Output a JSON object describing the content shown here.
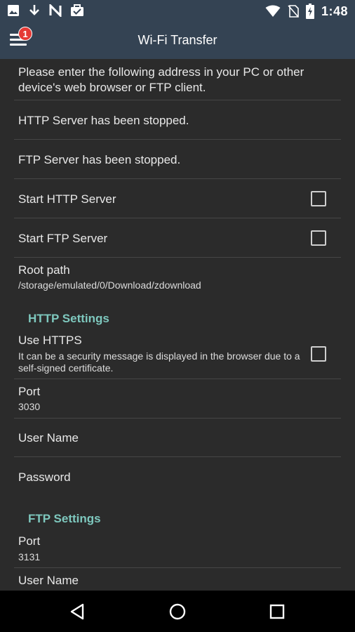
{
  "status_bar": {
    "time": "1:48",
    "left_icons": [
      "image-icon",
      "download-icon",
      "nfc-icon",
      "briefcase-icon"
    ],
    "right_icons": [
      "wifi-icon",
      "no-sim-icon",
      "battery-charging-icon"
    ]
  },
  "app_bar": {
    "title": "Wi-Fi Transfer",
    "menu_badge": "1"
  },
  "content": {
    "instructions": "Please enter the following address in your PC or other device's web browser or FTP client.",
    "http_status": "HTTP Server has been stopped.",
    "ftp_status": "FTP Server has been stopped.",
    "start_http": {
      "label": "Start HTTP Server",
      "checked": false
    },
    "start_ftp": {
      "label": "Start FTP Server",
      "checked": false
    },
    "root_path": {
      "label": "Root path",
      "value": "/storage/emulated/0/Download/zdownload"
    },
    "http_settings": {
      "header": "HTTP Settings",
      "use_https": {
        "label": "Use HTTPS",
        "summary": "It can be a security message is displayed in the browser due to a self-signed certificate.",
        "checked": false
      },
      "port": {
        "label": "Port",
        "value": "3030"
      },
      "user_name": {
        "label": "User Name"
      },
      "password": {
        "label": "Password"
      }
    },
    "ftp_settings": {
      "header": "FTP Settings",
      "port": {
        "label": "Port",
        "value": "3131"
      },
      "user_name": {
        "label": "User Name"
      }
    }
  },
  "nav_bar": {
    "buttons": [
      "back-icon",
      "home-icon",
      "recents-icon"
    ]
  },
  "colors": {
    "app_bar": "#344353",
    "background": "#2b2b2b",
    "section_header": "#7ec8be",
    "badge": "#e53935"
  }
}
